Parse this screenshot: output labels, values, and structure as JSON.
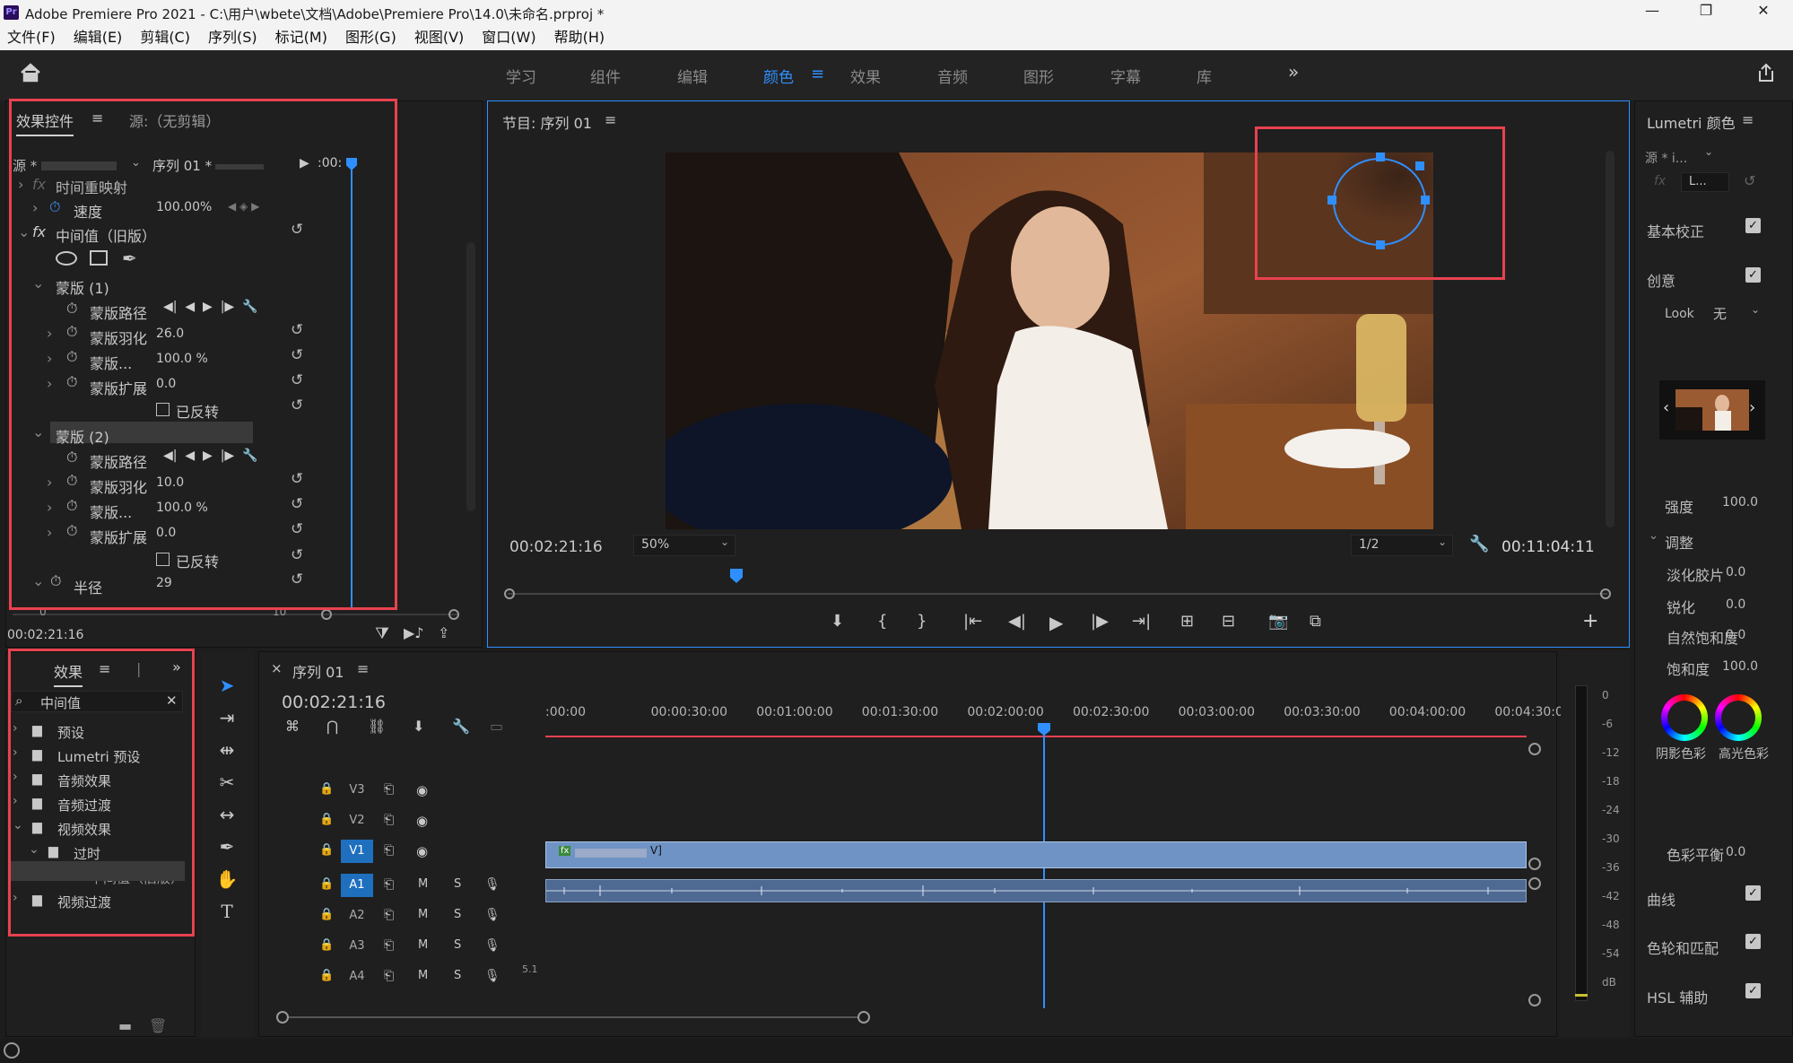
{
  "titlebar": {
    "app_icon": "Pr",
    "title": "Adobe Premiere Pro 2021 - C:\\用户\\wbete\\文档\\Adobe\\Premiere Pro\\14.0\\未命名.prproj *",
    "minimize": "—",
    "restore": "❐",
    "close": "✕"
  },
  "menu": [
    "文件(F)",
    "编辑(E)",
    "剪辑(C)",
    "序列(S)",
    "标记(M)",
    "图形(G)",
    "视图(V)",
    "窗口(W)",
    "帮助(H)"
  ],
  "workspaces": {
    "items": [
      "学习",
      "组件",
      "编辑",
      "颜色",
      "效果",
      "音频",
      "图形",
      "字幕",
      "库"
    ],
    "active": "颜色",
    "more": "»"
  },
  "effect_controls": {
    "tab_active": "效果控件",
    "tab_menu": "≡",
    "tab_source": "源:（无剪辑）",
    "source_label": "源 *",
    "sequence_label": "序列 01 *",
    "time_head": ":00:",
    "time_remap": "时间重映射",
    "speed_label": "速度",
    "speed_value": "100.00%",
    "fx_label": "fx",
    "effect_name": "中间值（旧版）",
    "mask1": {
      "title": "蒙版 (1)",
      "path": "蒙版路径",
      "feather": "蒙版羽化",
      "feather_val": "26.0",
      "opacity": "蒙版...",
      "opacity_val": "100.0 %",
      "expand": "蒙版扩展",
      "expand_val": "0.0",
      "inverted": "已反转"
    },
    "mask2": {
      "title": "蒙版 (2)",
      "path": "蒙版路径",
      "feather": "蒙版羽化",
      "feather_val": "10.0",
      "opacity": "蒙版...",
      "opacity_val": "100.0 %",
      "expand": "蒙版扩展",
      "expand_val": "0.0",
      "inverted": "已反转"
    },
    "radius_label": "半径",
    "radius_val": "29",
    "scale_start": "0",
    "scale_end": "10",
    "timecode": "00:02:21:16"
  },
  "program": {
    "title": "节目: 序列 01",
    "menu": "≡",
    "timecode": "00:02:21:16",
    "zoom": "50%",
    "resolution": "1/2",
    "duration": "00:11:04:11",
    "add": "+"
  },
  "effects_panel": {
    "tab": "效果",
    "menu": "≡",
    "sep": "|",
    "more": "»",
    "search_value": "中间值",
    "clear": "✕",
    "tree": [
      {
        "label": "预设",
        "indent": 0,
        "arrow": "›"
      },
      {
        "label": "Lumetri 预设",
        "indent": 0,
        "arrow": "›"
      },
      {
        "label": "音频效果",
        "indent": 0,
        "arrow": "›"
      },
      {
        "label": "音频过渡",
        "indent": 0,
        "arrow": "›"
      },
      {
        "label": "视频效果",
        "indent": 0,
        "arrow": "⌄"
      },
      {
        "label": "过时",
        "indent": 1,
        "arrow": "⌄"
      },
      {
        "label": "中间值（旧版）",
        "indent": 2,
        "arrow": ""
      },
      {
        "label": "视频过渡",
        "indent": 0,
        "arrow": "›"
      }
    ]
  },
  "timeline": {
    "close": "×",
    "title": "序列 01",
    "menu": "≡",
    "timecode": "00:02:21:16",
    "ruler": [
      ":00:00",
      "00:00:30:00",
      "00:01:00:00",
      "00:01:30:00",
      "00:02:00:00",
      "00:02:30:00",
      "00:03:00:00",
      "00:03:30:00",
      "00:04:00:00",
      "00:04:30:00"
    ],
    "tracks": [
      {
        "name": "V3",
        "type": "video"
      },
      {
        "name": "V2",
        "type": "video"
      },
      {
        "name": "V1",
        "type": "video",
        "active": true
      },
      {
        "name": "A1",
        "type": "audio",
        "active": true
      },
      {
        "name": "A2",
        "type": "audio"
      },
      {
        "name": "A3",
        "type": "audio"
      },
      {
        "name": "A4",
        "type": "audio",
        "extra": "5.1"
      }
    ],
    "mute": "M",
    "solo": "S",
    "a5_extra": "5.1",
    "clip_fx": "fx",
    "clip_end": "V]"
  },
  "meters": [
    "0",
    "-6",
    "-12",
    "-18",
    "-24",
    "-30",
    "-36",
    "-42",
    "-48",
    "-54",
    "dB"
  ],
  "lumetri": {
    "title": "Lumetri 颜色",
    "menu": "≡",
    "source": "源 * i...",
    "seq_short": "L...",
    "fx": "fx",
    "basic": "基本校正",
    "creative": "创意",
    "look_label": "Look",
    "look_value": "无",
    "intensity": "强度",
    "intensity_val": "100.0",
    "adjust": "调整",
    "faded": "淡化胶片",
    "faded_val": "0.0",
    "sharpen": "锐化",
    "sharpen_val": "0.0",
    "vibrance": "自然饱和度",
    "vibrance_val": "0.0",
    "saturation": "饱和度",
    "saturation_val": "100.0",
    "shadow_tint": "阴影色彩",
    "highlight_tint": "高光色彩",
    "balance": "色彩平衡",
    "balance_val": "0.0",
    "curves": "曲线",
    "wheels": "色轮和匹配",
    "hsl": "HSL 辅助"
  },
  "colors": {
    "accent": "#2f8fff",
    "highlight_box": "#e8424f",
    "playhead": "#2f8fff",
    "clip_video": "#6f93c4",
    "clip_audio": "#4f6a92"
  }
}
